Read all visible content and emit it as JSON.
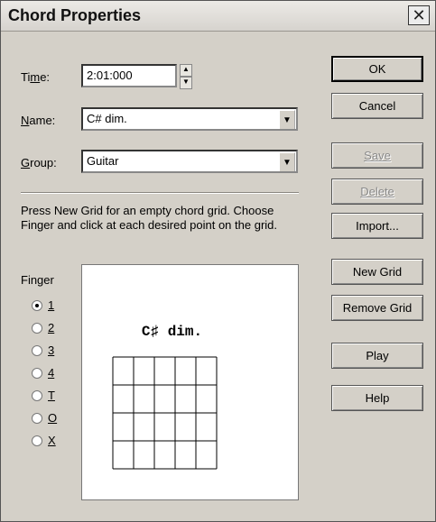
{
  "window": {
    "title": "Chord Properties"
  },
  "fields": {
    "time": {
      "label_pre": "Ti",
      "label_u": "m",
      "label_post": "e:",
      "value": "2:01:000"
    },
    "name": {
      "label_u": "N",
      "label_post": "ame:",
      "value": "C# dim."
    },
    "group": {
      "label_u": "G",
      "label_post": "roup:",
      "value": "Guitar"
    }
  },
  "instructions": "Press New Grid for an empty chord grid. Choose Finger and click at each desired point on the grid.",
  "finger": {
    "label": "Finger",
    "options": [
      {
        "label": "1",
        "selected": true
      },
      {
        "label": "2",
        "selected": false
      },
      {
        "label": "3",
        "selected": false
      },
      {
        "label": "4",
        "selected": false
      },
      {
        "label": "T",
        "selected": false
      },
      {
        "label": "O",
        "selected": false
      },
      {
        "label": "X",
        "selected": false
      }
    ]
  },
  "grid": {
    "chord_name": "C♯ dim.",
    "strings": 6,
    "frets": 4
  },
  "buttons": {
    "ok": "OK",
    "cancel": "Cancel",
    "save": "Save",
    "delete": "Delete",
    "import": "Import...",
    "new_grid": "New Grid",
    "remove_grid": "Remove Grid",
    "play": "Play",
    "help": "Help"
  },
  "icons": {
    "close": "close-icon",
    "spin": "spin-icon",
    "dropdown": "chevron-down-icon"
  }
}
